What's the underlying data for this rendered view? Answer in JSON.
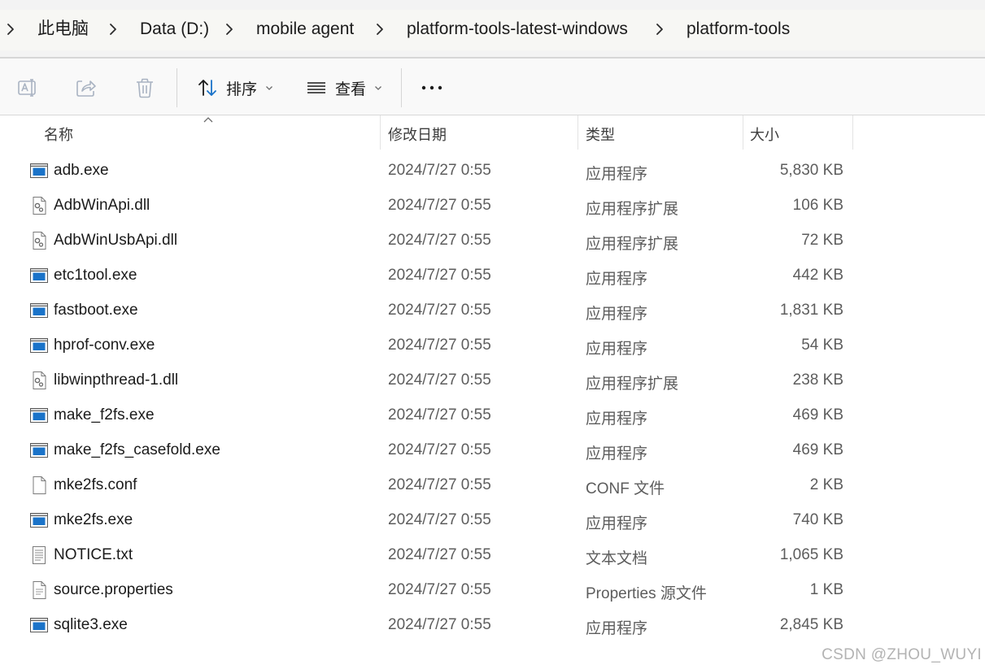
{
  "breadcrumb": {
    "items": [
      "此电脑",
      "Data (D:)",
      "mobile agent",
      "platform-tools-latest-windows",
      "platform-tools"
    ]
  },
  "toolbar": {
    "icons": [
      "rename-icon",
      "share-icon",
      "delete-icon"
    ],
    "sort_label": "排序",
    "view_label": "查看",
    "more_label": "•••"
  },
  "columns": {
    "name": "名称",
    "date": "修改日期",
    "type": "类型",
    "size": "大小"
  },
  "files": [
    {
      "name": "adb.exe",
      "date": "2024/7/27 0:55",
      "type": "应用程序",
      "size": "5,830 KB",
      "icon": "exe"
    },
    {
      "name": "AdbWinApi.dll",
      "date": "2024/7/27 0:55",
      "type": "应用程序扩展",
      "size": "106 KB",
      "icon": "dll"
    },
    {
      "name": "AdbWinUsbApi.dll",
      "date": "2024/7/27 0:55",
      "type": "应用程序扩展",
      "size": "72 KB",
      "icon": "dll"
    },
    {
      "name": "etc1tool.exe",
      "date": "2024/7/27 0:55",
      "type": "应用程序",
      "size": "442 KB",
      "icon": "exe"
    },
    {
      "name": "fastboot.exe",
      "date": "2024/7/27 0:55",
      "type": "应用程序",
      "size": "1,831 KB",
      "icon": "exe"
    },
    {
      "name": "hprof-conv.exe",
      "date": "2024/7/27 0:55",
      "type": "应用程序",
      "size": "54 KB",
      "icon": "exe"
    },
    {
      "name": "libwinpthread-1.dll",
      "date": "2024/7/27 0:55",
      "type": "应用程序扩展",
      "size": "238 KB",
      "icon": "dll"
    },
    {
      "name": "make_f2fs.exe",
      "date": "2024/7/27 0:55",
      "type": "应用程序",
      "size": "469 KB",
      "icon": "exe"
    },
    {
      "name": "make_f2fs_casefold.exe",
      "date": "2024/7/27 0:55",
      "type": "应用程序",
      "size": "469 KB",
      "icon": "exe"
    },
    {
      "name": "mke2fs.conf",
      "date": "2024/7/27 0:55",
      "type": "CONF 文件",
      "size": "2 KB",
      "icon": "blank"
    },
    {
      "name": "mke2fs.exe",
      "date": "2024/7/27 0:55",
      "type": "应用程序",
      "size": "740 KB",
      "icon": "exe"
    },
    {
      "name": "NOTICE.txt",
      "date": "2024/7/27 0:55",
      "type": "文本文档",
      "size": "1,065 KB",
      "icon": "txt"
    },
    {
      "name": "source.properties",
      "date": "2024/7/27 0:55",
      "type": "Properties 源文件",
      "size": "1 KB",
      "icon": "props"
    },
    {
      "name": "sqlite3.exe",
      "date": "2024/7/27 0:55",
      "type": "应用程序",
      "size": "2,845 KB",
      "icon": "exe"
    }
  ],
  "watermark": "CSDN @ZHOU_WUYI",
  "colors": {
    "exe_icon_blue": "#1a73c9",
    "toolbar_icon_gray": "#9aa4b4",
    "address_bg": "#f7f7f4"
  }
}
